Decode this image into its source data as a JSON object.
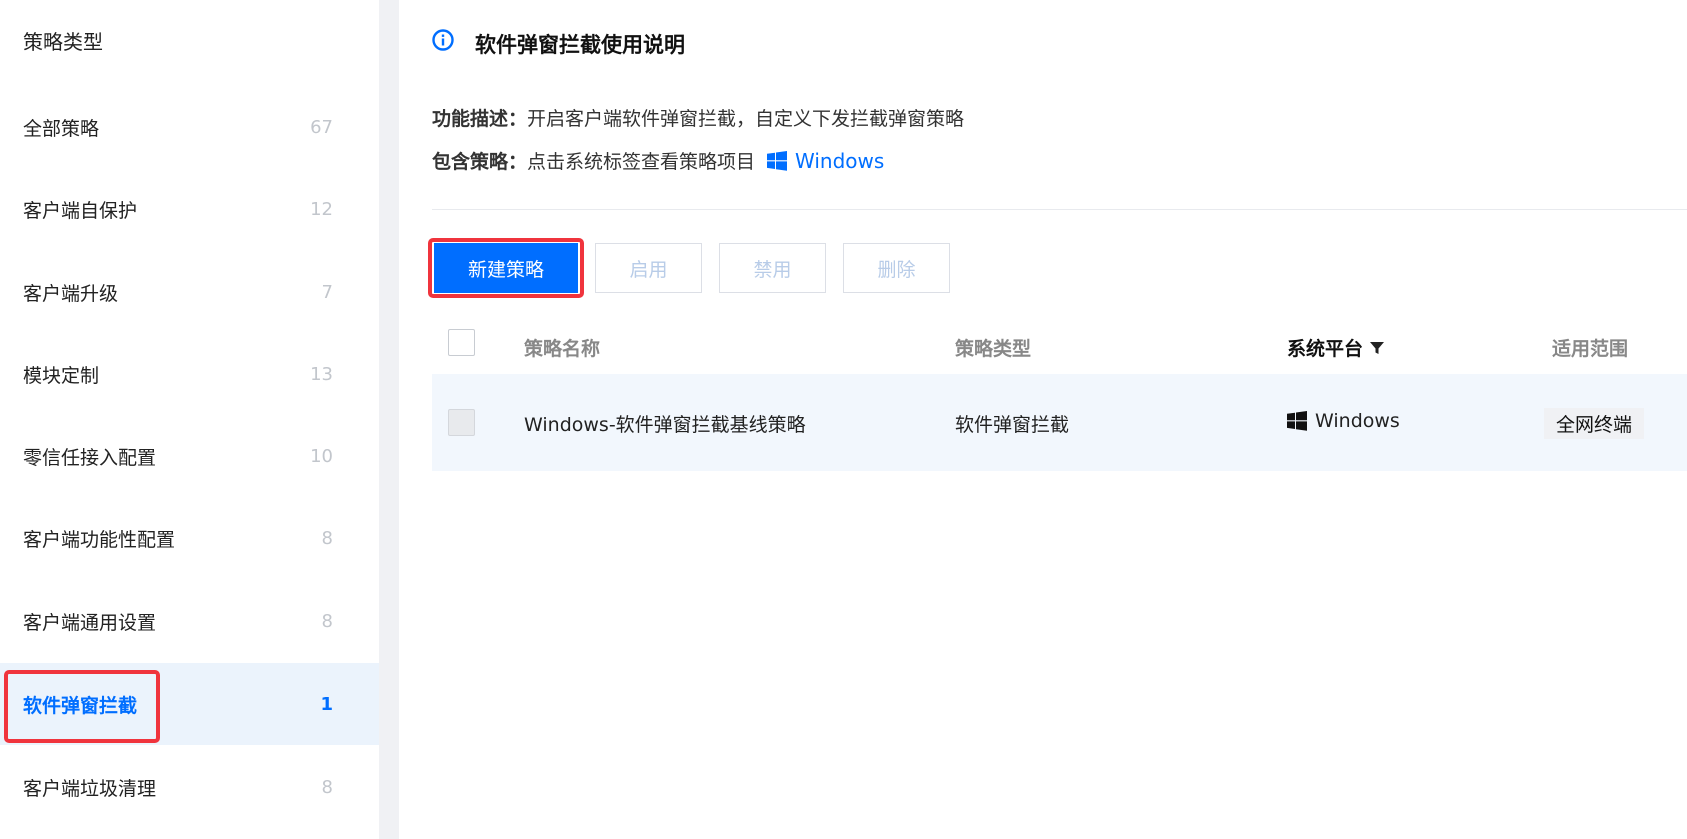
{
  "sidebar": {
    "title": "策略类型",
    "items": [
      {
        "label": "全部策略",
        "count": "67"
      },
      {
        "label": "客户端自保护",
        "count": "12"
      },
      {
        "label": "客户端升级",
        "count": "7"
      },
      {
        "label": "模块定制",
        "count": "13"
      },
      {
        "label": "零信任接入配置",
        "count": "10"
      },
      {
        "label": "客户端功能性配置",
        "count": "8"
      },
      {
        "label": "客户端通用设置",
        "count": "8"
      },
      {
        "label": "软件弹窗拦截",
        "count": "1",
        "active": true
      },
      {
        "label": "客户端垃圾清理",
        "count": "8"
      }
    ]
  },
  "notice": {
    "title": "软件弹窗拦截使用说明",
    "desc_key": "功能描述：",
    "desc_value": "开启客户端软件弹窗拦截，自定义下发拦截弹窗策略",
    "include_key": "包含策略：",
    "include_value": "点击系统标签查看策略项目",
    "platform_link": "Windows"
  },
  "toolbar": {
    "new_label": "新建策略",
    "enable_label": "启用",
    "disable_label": "禁用",
    "delete_label": "删除"
  },
  "table": {
    "headers": {
      "name": "策略名称",
      "type": "策略类型",
      "platform": "系统平台",
      "scope": "适用范围"
    },
    "rows": [
      {
        "name": "Windows-软件弹窗拦截基线策略",
        "type": "软件弹窗拦截",
        "platform": "Windows",
        "scope": "全网终端"
      }
    ]
  },
  "colors": {
    "accent": "#006eff",
    "highlight": "#f0343d",
    "active_bg": "#ebf3fc"
  }
}
